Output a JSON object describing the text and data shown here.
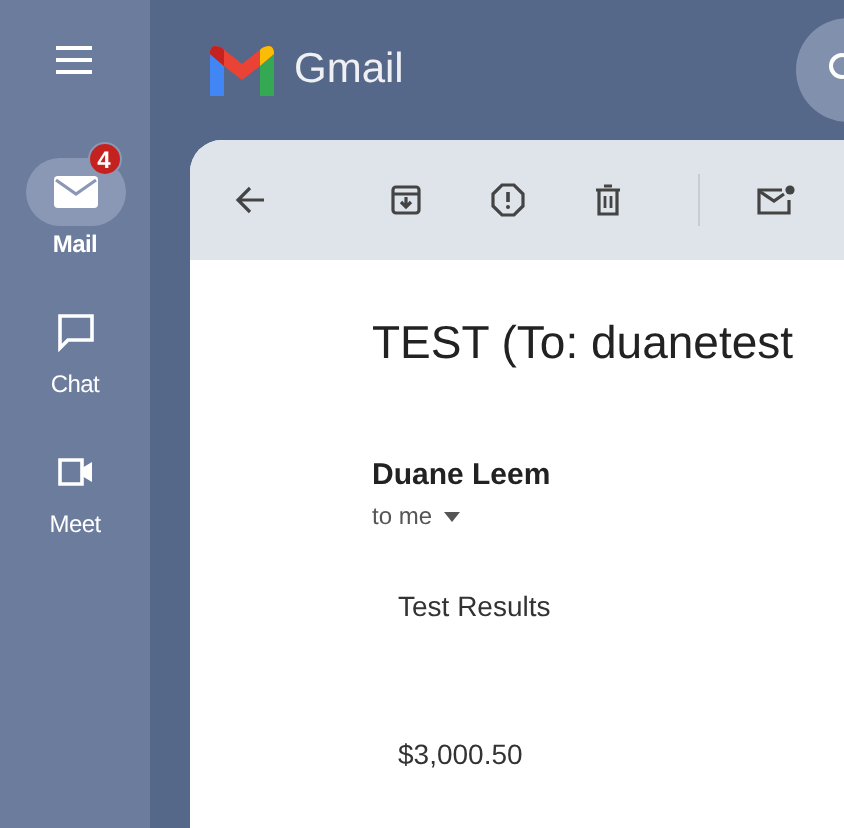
{
  "app": {
    "name": "Gmail"
  },
  "rail": [
    {
      "kind": "mail",
      "label": "Mail",
      "selected": true,
      "badge": "4"
    },
    {
      "kind": "chat",
      "label": "Chat",
      "selected": false
    },
    {
      "kind": "meet",
      "label": "Meet",
      "selected": false
    }
  ],
  "message": {
    "subject": "TEST (To: duanetest",
    "sender": "Duane Leem",
    "recipient": "to me",
    "body": [
      "Test Results",
      "$3,000.50"
    ]
  }
}
